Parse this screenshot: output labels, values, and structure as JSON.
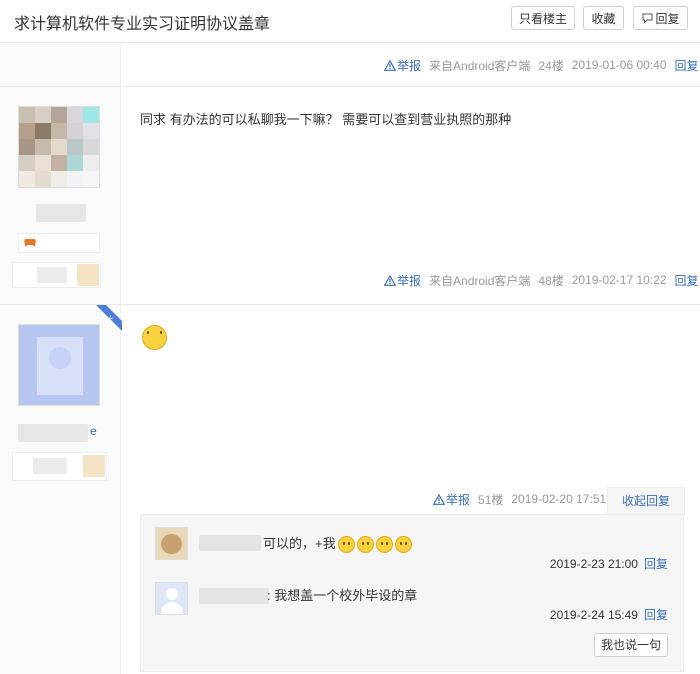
{
  "thread": {
    "title": "求计算机软件专业实习证明协议盖章"
  },
  "toolbar": {
    "only_op": "只看楼主",
    "favorite": "收藏",
    "reply": "回复"
  },
  "posts": [
    {
      "report": "举报",
      "source": "来自Android客户端",
      "floor": "24楼",
      "time": "2019-01-06 00:40",
      "reply": "回复"
    },
    {
      "text": "同求 有办法的可以私聊我一下嘛？ 需要可以查到营业执照的那种",
      "report": "举报",
      "source": "来自Android客户端",
      "floor": "48楼",
      "time": "2019-02-17 10:22",
      "reply": "回复"
    },
    {
      "report": "举报",
      "floor": "51楼",
      "time": "2019-02-20 17:51",
      "collapse": "收起回复",
      "username_suffix": "e"
    }
  ],
  "comments": [
    {
      "text": "可以的，+我",
      "time": "2019-2-23 21:00",
      "reply": "回复"
    },
    {
      "text": ": 我想盖一个校外毕设的章",
      "time": "2019-2-24 15:49",
      "reply": "回复"
    }
  ],
  "say_button": "我也说一句",
  "colors": {
    "link": "#3a6fb6",
    "meta": "#999999",
    "divider": "#e8e8e8"
  }
}
